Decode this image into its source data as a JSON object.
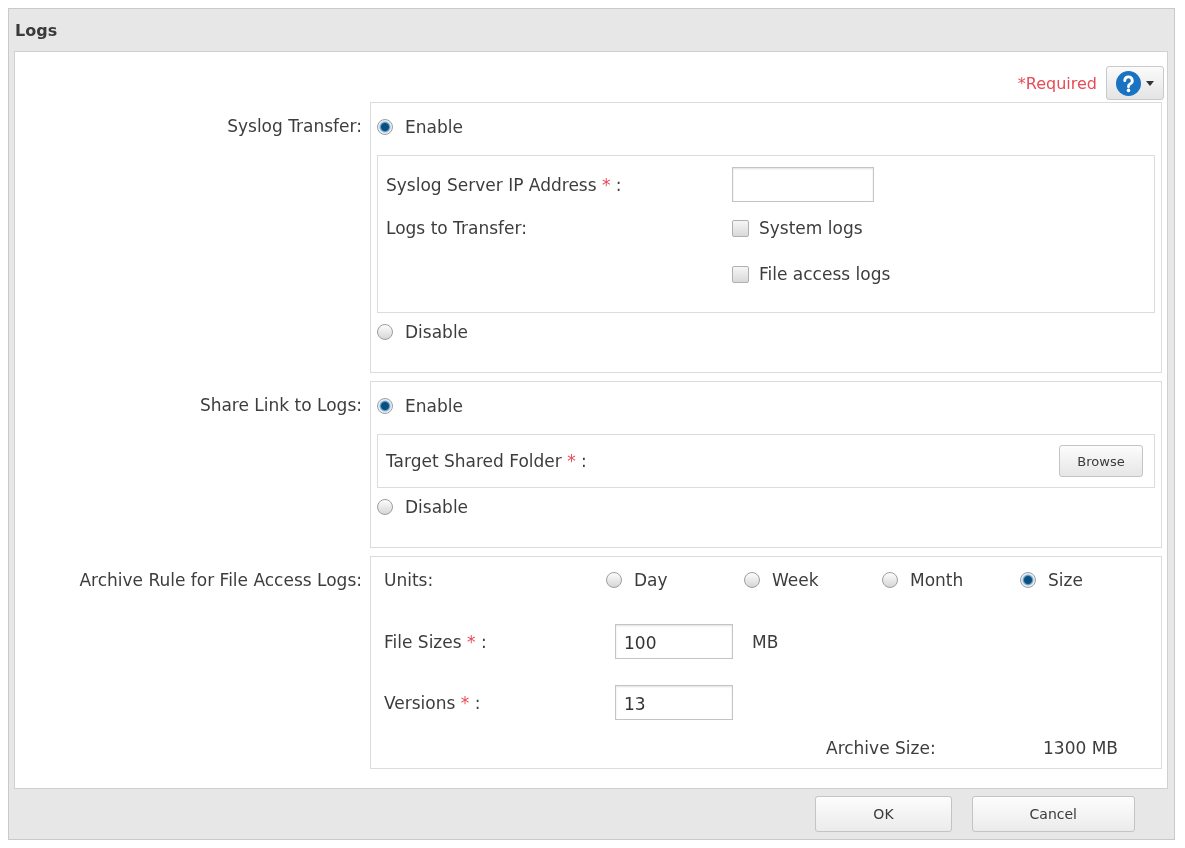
{
  "window": {
    "title": "Logs"
  },
  "header": {
    "required_note": "*Required"
  },
  "sections": [
    {
      "kind": "toggle",
      "label": "Syslog Transfer:",
      "options": [
        {
          "label": "Enable",
          "selected": true
        },
        {
          "label": "Disable",
          "selected": false
        }
      ],
      "details": [
        {
          "kind": "text_input",
          "label": "Syslog Server IP Address",
          "required_mark": "*",
          "colon": ":"
        },
        {
          "kind": "checkbox_group",
          "label": "Logs to Transfer:",
          "checkboxes": [
            {
              "label": "System logs",
              "checked": false
            },
            {
              "label": "File access logs",
              "checked": false
            }
          ]
        }
      ]
    },
    {
      "kind": "toggle",
      "label": "Share Link to Logs:",
      "options": [
        {
          "label": "Enable",
          "selected": true
        },
        {
          "label": "Disable",
          "selected": false
        }
      ],
      "details": [
        {
          "kind": "browse",
          "label": "Target Shared Folder",
          "required_mark": "*",
          "colon": ":",
          "button": "Browse"
        }
      ]
    },
    {
      "kind": "archive",
      "label": "Archive Rule for File Access Logs:",
      "units": {
        "label": "Units:",
        "options": [
          {
            "label": "Day",
            "selected": false
          },
          {
            "label": "Week",
            "selected": false
          },
          {
            "label": "Month",
            "selected": false
          },
          {
            "label": "Size",
            "selected": true
          }
        ]
      },
      "fields": [
        {
          "label": "File Sizes",
          "required_mark": "*",
          "colon": ":",
          "value": "100",
          "unit": "MB"
        },
        {
          "label": "Versions",
          "required_mark": "*",
          "colon": ":",
          "value": "13"
        }
      ],
      "summary": {
        "label": "Archive Size:",
        "value": "1300 MB"
      }
    }
  ],
  "footer": {
    "buttons": [
      "OK",
      "Cancel"
    ]
  }
}
